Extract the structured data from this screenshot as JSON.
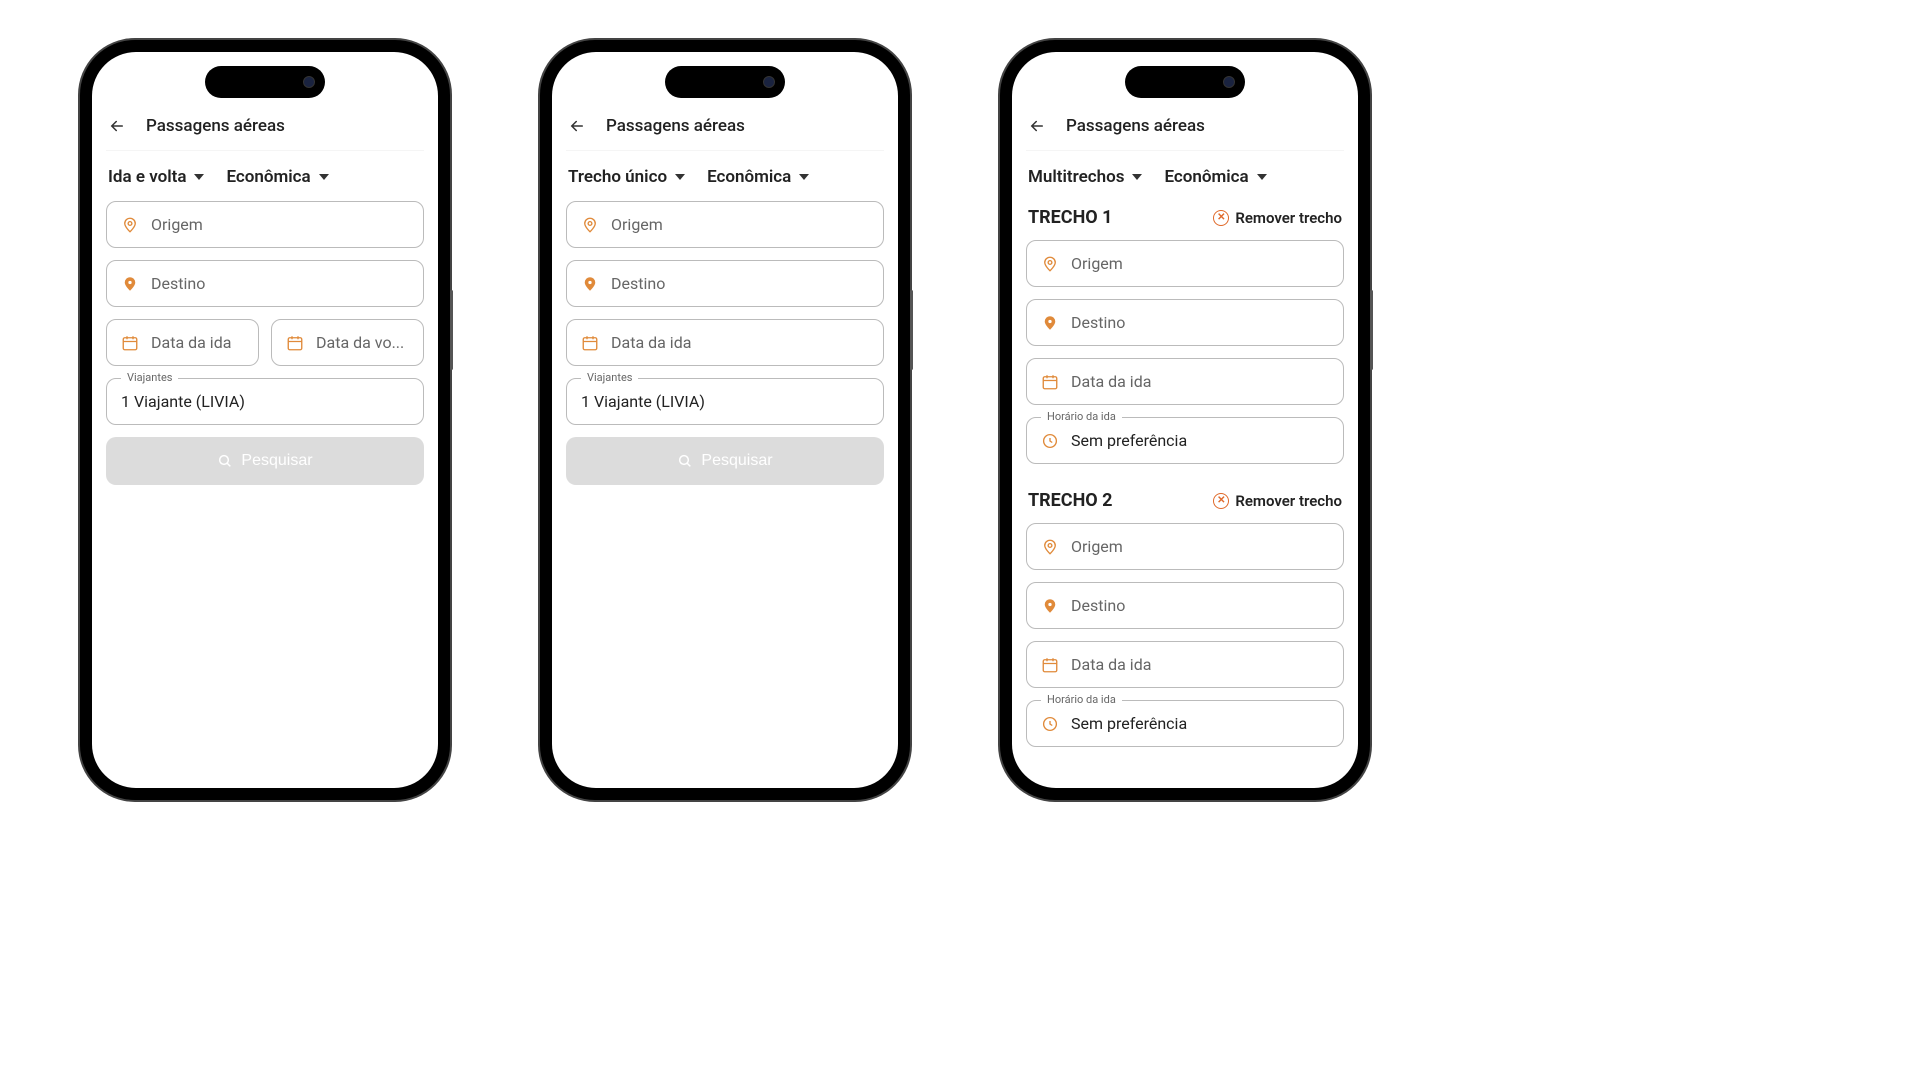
{
  "colors": {
    "accent": "#e08a3a"
  },
  "header": {
    "title": "Passagens aéreas"
  },
  "search_label": "Pesquisar",
  "class_label": "Econômica",
  "travelers": {
    "float_label": "Viajantes",
    "value": "1 Viajante (LIVIA)"
  },
  "phone1": {
    "trip_type": "Ida e volta",
    "origin": "Origem",
    "destination": "Destino",
    "date_out": "Data da ida",
    "date_back": "Data da vo..."
  },
  "phone2": {
    "trip_type": "Trecho único",
    "origin": "Origem",
    "destination": "Destino",
    "date_out": "Data da ida"
  },
  "phone3": {
    "trip_type": "Multitrechos",
    "remove_label": "Remover trecho",
    "segments": [
      {
        "title": "TRECHO 1",
        "origin": "Origem",
        "destination": "Destino",
        "date_out": "Data da ida",
        "time_float": "Horário da ida",
        "time_value": "Sem preferência"
      },
      {
        "title": "TRECHO 2",
        "origin": "Origem",
        "destination": "Destino",
        "date_out": "Data da ida",
        "time_float": "Horário da ida",
        "time_value": "Sem preferência"
      }
    ]
  }
}
